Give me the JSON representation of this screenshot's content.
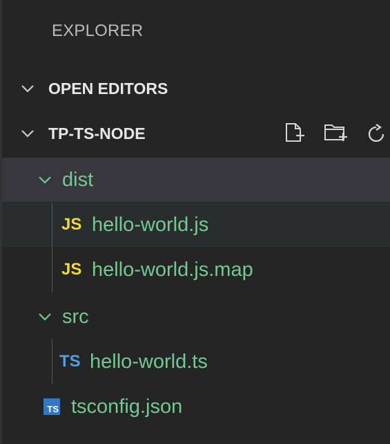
{
  "explorer": {
    "title": "EXPLORER",
    "open_editors": {
      "label": "OPEN EDITORS",
      "icon": "chevron-down-icon"
    },
    "project": {
      "label": "TP-TS-NODE",
      "icon": "chevron-down-icon",
      "actions": [
        "new-file-icon",
        "new-folder-icon",
        "refresh-icon"
      ]
    },
    "tree": [
      {
        "type": "folder",
        "name": "dist",
        "expanded": true
      },
      {
        "type": "file",
        "name": "hello-world.js",
        "badge": "JS"
      },
      {
        "type": "file",
        "name": "hello-world.js.map",
        "badge": "JS"
      },
      {
        "type": "folder",
        "name": "src",
        "expanded": true
      },
      {
        "type": "file",
        "name": "hello-world.ts",
        "badge": "TS"
      },
      {
        "type": "file",
        "name": "tsconfig.json",
        "badge": "TS"
      }
    ],
    "colors": {
      "background": "#252526",
      "selected_row": "#37373d",
      "hover_row": "#2a2d2e",
      "file_text": "#73c991",
      "js_badge": "#f1d93a",
      "ts_badge": "#4fa0e3",
      "tsconfig_icon": "#3178c6"
    }
  }
}
